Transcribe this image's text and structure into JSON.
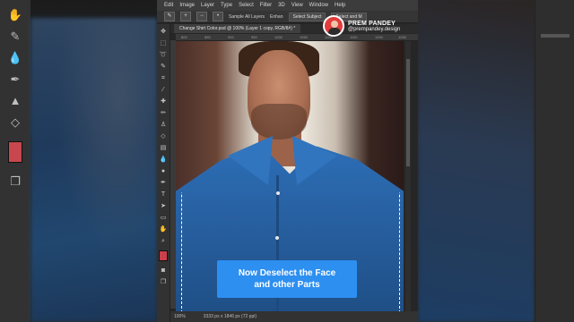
{
  "menubar": {
    "items": [
      "Edit",
      "Image",
      "Layer",
      "Type",
      "Select",
      "Filter",
      "3D",
      "View",
      "Window",
      "Help"
    ]
  },
  "optionsbar": {
    "sample_all_layers": "Sample All Layers",
    "enhance": "Enhan",
    "select_subject": "Select Subject",
    "select_and_mask": "Select and M"
  },
  "document": {
    "tab_title": "Change Shirt Color.psd @ 100% (Layer 1 copy, RGB/8#) *"
  },
  "ruler": {
    "ticks": [
      "800",
      "850",
      "900",
      "950",
      "1000",
      "1050",
      "1100",
      "1150",
      "1200",
      "1250"
    ]
  },
  "statusbar": {
    "zoom": "100%",
    "doc_size": "3333 px x 1846 px (72 ppi)"
  },
  "creator": {
    "name": "PREM PANDEY",
    "handle": "@prempandey.design"
  },
  "caption": {
    "line1": "Now Deselect the Face",
    "line2": "and other Parts"
  },
  "colors": {
    "accent": "#2d8ff0",
    "foreground_swatch": "#c9404b",
    "shirt": "#2d6fb8"
  }
}
